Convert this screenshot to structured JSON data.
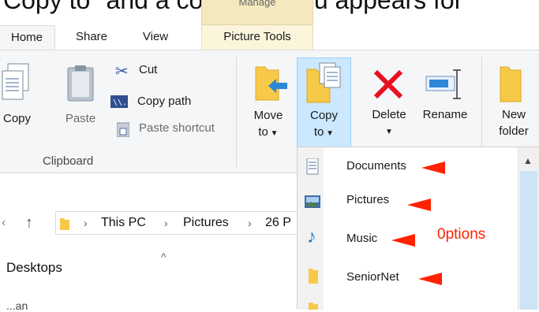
{
  "caption": "Copy to\" and a context menu appears for",
  "manage_label": "Manage",
  "tabs": [
    "Home",
    "Share",
    "View",
    "Picture Tools"
  ],
  "ribbon": {
    "copy": "Copy",
    "paste": "Paste",
    "cut": "Cut",
    "copy_path": "Copy path",
    "paste_shortcut": "Paste shortcut",
    "clipboard": "Clipboard",
    "move_to_1": "Move",
    "move_to_2": "to",
    "copy_to_1": "Copy",
    "copy_to_2": "to",
    "delete": "Delete",
    "rename": "Rename",
    "new_folder_1": "New",
    "new_folder_2": "folder"
  },
  "address": {
    "crumbs": [
      "This PC",
      "Pictures",
      "26 P"
    ]
  },
  "nav": {
    "desktops": "Desktops",
    "partial": "...an"
  },
  "menu": {
    "items": [
      "Documents",
      "Pictures",
      "Music",
      "SeniorNet"
    ]
  },
  "annotation": "0ptions",
  "colors": {
    "accent": "#cce8ff",
    "annotation": "#ff2200",
    "folder": "#f7c948"
  }
}
